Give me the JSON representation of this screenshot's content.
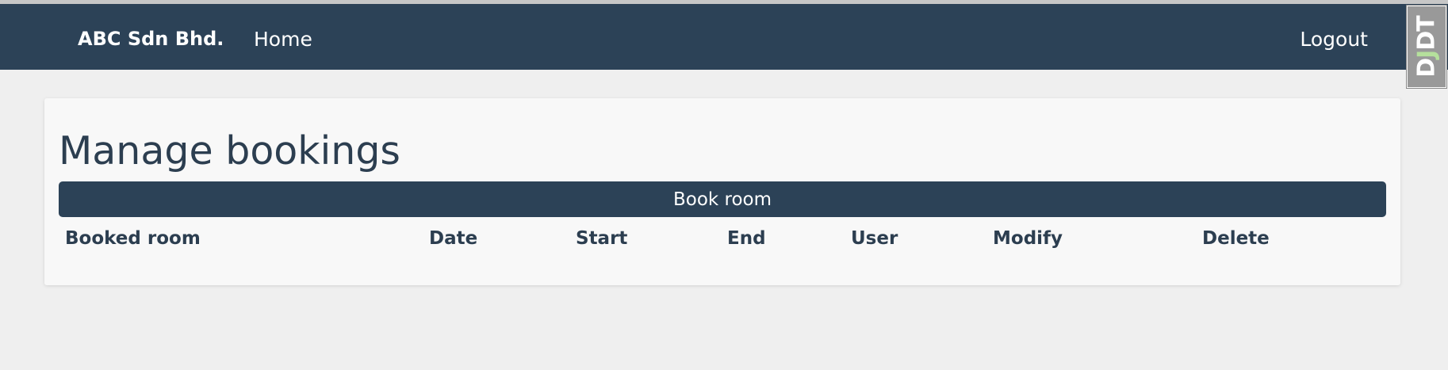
{
  "navbar": {
    "brand": "ABC Sdn Bhd.",
    "home_label": "Home",
    "logout_label": "Logout"
  },
  "debug_toolbar": {
    "label_d": "D",
    "label_j": "J",
    "label_dt": "DT"
  },
  "main": {
    "title": "Manage bookings",
    "book_button_label": "Book room",
    "table": {
      "headers": [
        "Booked room",
        "Date",
        "Start",
        "End",
        "User",
        "Modify",
        "Delete"
      ],
      "rows": []
    }
  },
  "colors": {
    "navbar_bg": "#2c4257",
    "page_bg": "#efefef",
    "card_bg": "#f8f8f8",
    "text_primary": "#2c3e50",
    "button_bg": "#2c4257"
  }
}
